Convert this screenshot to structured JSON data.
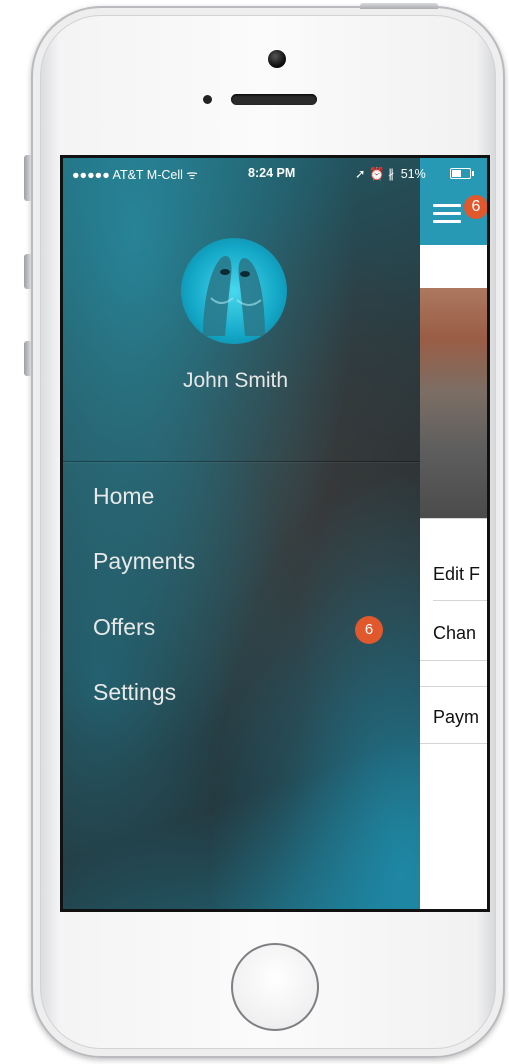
{
  "status_bar": {
    "carrier": "●●●●● AT&T M-Cell",
    "wifi_icon": "ᯤ",
    "time": "8:24 PM",
    "indicators": "➚ ⏰ ∦",
    "battery_percent": "51%",
    "battery_level": 0.51
  },
  "profile": {
    "name": "John Smith",
    "avatar_icon": "dolphins-photo"
  },
  "menu": {
    "items": [
      {
        "label": "Home"
      },
      {
        "label": "Payments"
      },
      {
        "label": "Offers",
        "badge": "6"
      },
      {
        "label": "Settings"
      }
    ]
  },
  "main_panel": {
    "menu_badge": "6",
    "rows": [
      "Edit F",
      "Chan",
      "Paym"
    ]
  },
  "colors": {
    "accent": "#2899b5",
    "badge": "#e0582c"
  }
}
